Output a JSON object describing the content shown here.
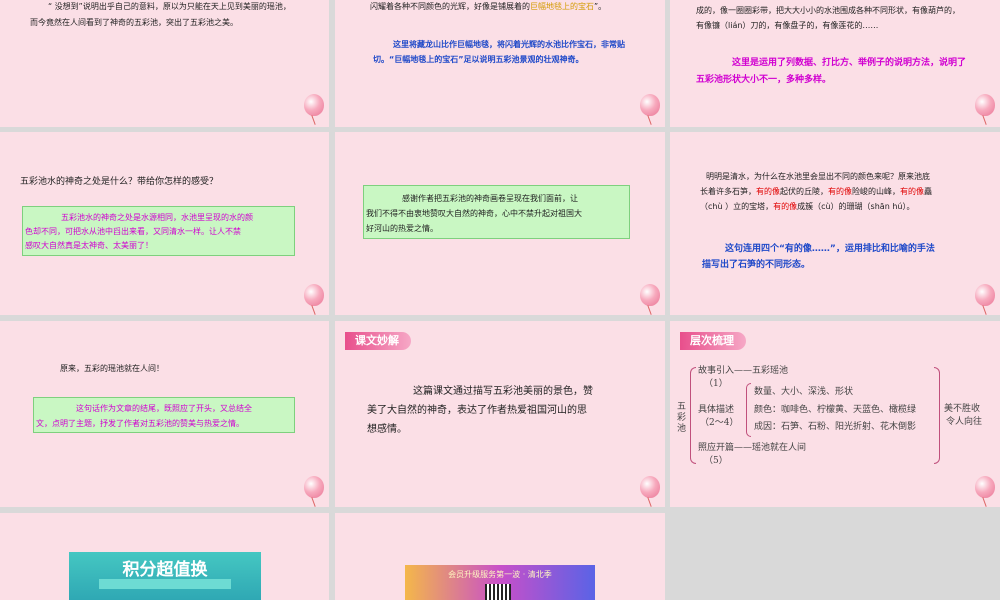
{
  "slide1": {
    "line1": "“ 没想到”说明出乎自己的意料，原以为只能在天上见到美丽的瑶池，",
    "line2": "而今竟然在人间看到了神奇的五彩池，突出了五彩池之美。"
  },
  "slide2": {
    "text_a": "闪耀着各种不同颜色的光辉，好像是铺展着的",
    "text_b": "巨幅地毯上的宝石",
    "text_c": "”。",
    "note1": "这里将藏龙山比作巨幅地毯，将闪着光辉的水池比作宝石，非常贴",
    "note2": "切。“巨幅地毯上的宝石”足以说明五彩池景观的壮观神奇。"
  },
  "slide3": {
    "line1": "成的，像一圈圈彩带，把大大小小的水池围成各种不同形状，有像葫芦的，",
    "line2": "有像镰（lián）刀的，有像盘子的，有像莲花的……",
    "note1": "这里是运用了列数据、打比方、举例子的说明方法，说明了",
    "note2": "五彩池形状大小不一，多种多样。"
  },
  "slide4": {
    "question": "五彩池水的神奇之处是什么？带给你怎样的感受？",
    "answer1": "五彩池水的神奇之处是水源相同，水池里呈现的水的颜",
    "answer2": "色却不同，可把水从池中舀出来看，又同清水一样。让人不禁",
    "answer3": "感叹大自然真是太神奇、太美丽了！"
  },
  "slide5": {
    "line1": "感谢作者把五彩池的神奇画卷呈现在我们面前，让",
    "line2": "我们不得不由衷地赞叹大自然的神奇，心中不禁升起对祖国大",
    "line3": "好河山的热爱之情。"
  },
  "slide6": {
    "line1": "明明是清水，为什么在水池里会显出不同的颜色来呢？原来池底",
    "l2a": "长着许多石笋，",
    "l2b": "有的像",
    "l2c": "起伏的丘陵，",
    "l2d": "有的像",
    "l2e": "险峻的山峰，",
    "l2f": "有的像",
    "l2g": "矗",
    "l3a": "（chù ）立的宝塔，",
    "l3b": "有的像",
    "l3c": "成簇（cù）的珊瑚（shān hú）。",
    "note1": "这句连用四个“有的像……”，运用排比和比喻的手法",
    "note2": "描写出了石笋的不同形态。"
  },
  "slide7": {
    "text": "原来，五彩的瑶池就在人间！",
    "note1": "这句话作为文章的结尾，既照应了开头，又总结全",
    "note2": "文，点明了主题，抒发了作者对五彩池的赞美与热爱之情。"
  },
  "slide8": {
    "tag": "课文妙解",
    "line1": "这篇课文通过描写五彩池美丽的景色，赞",
    "line2": "美了大自然的神奇，表达了作者热爱祖国河山的思",
    "line3": "想感情。"
  },
  "slide9": {
    "tag": "层次梳理",
    "root1": "五",
    "root2": "彩",
    "root3": "池",
    "b1": "故事引入——五彩瑶池",
    "b1n": "（1）",
    "b2": "具体描述",
    "b2n": "（2～4）",
    "s1": "数量、大小、深浅、形状",
    "s2": "颜色：咖啡色、柠檬黄、天蓝色、橄榄绿",
    "s3": "成因：石笋、石粉、阳光折射、花木倒影",
    "b3": "照应开篇——瑶池就在人间",
    "b3n": "（5）",
    "r1": "美不胜收",
    "r2": "令人向往"
  },
  "slide10": {
    "title": "积分超值换"
  },
  "slide11": {
    "banner": "会员升级服务第一波 · 清北季"
  }
}
